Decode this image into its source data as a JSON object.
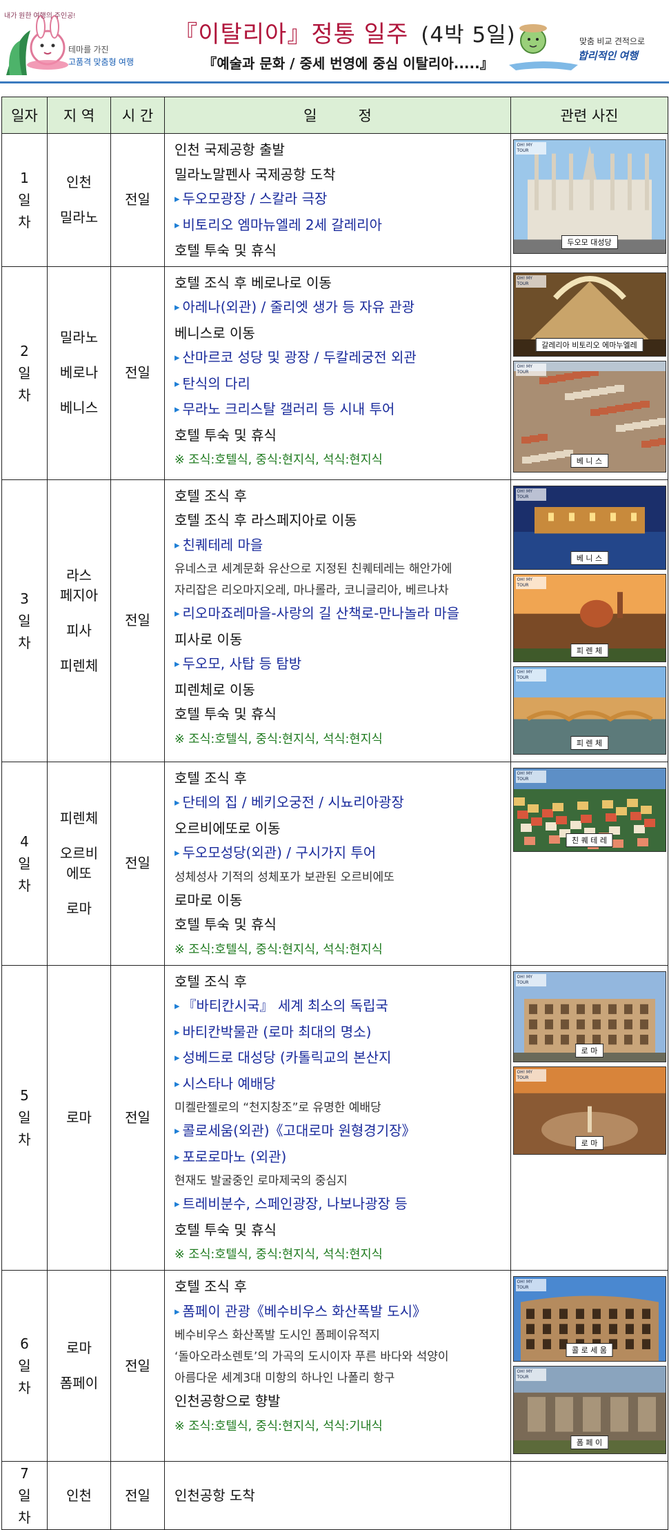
{
  "header": {
    "left_logo_bubble": "내가 원한 여행의 주인공!",
    "left_logo_line1": "테마를 가진",
    "left_logo_line2": "고품격 맞춤형 여행",
    "title": "『이탈리아』정통 일주",
    "duration": "(4박 5일)",
    "subtitle": "『예술과 문화 / 중세 번영에 중심 이탈리아.....』",
    "right_logo_line1": "맞춤 비교 견적으로",
    "right_logo_line2": "합리적인 여행"
  },
  "table": {
    "headers": {
      "day": "일자",
      "region": "지 역",
      "time": "시 간",
      "schedule": "일         정",
      "photos": "관련 사진"
    },
    "stamp": "OH! MY TOUR",
    "rows": [
      {
        "day": [
          "1",
          "일",
          "차"
        ],
        "regions": [
          "인천",
          "밀라노"
        ],
        "time": "전일",
        "lines": [
          {
            "t": "인천 국제공항 출발",
            "k": "plain"
          },
          {
            "t": "밀라노말펜사 국제공항 도착",
            "k": "plain"
          },
          {
            "t": "두오모광장 / 스칼라 극장",
            "k": "hl"
          },
          {
            "t": "비토리오 엠마뉴엘레 2세 갈레리아",
            "k": "hl"
          },
          {
            "t": "호텔 투숙 및 휴식",
            "k": "plain"
          }
        ],
        "photos": [
          {
            "caption": "두오모 대성당",
            "scene": "cathedral"
          }
        ]
      },
      {
        "day": [
          "2",
          "일",
          "차"
        ],
        "regions": [
          "밀라노",
          "베로나",
          "베니스"
        ],
        "time": "전일",
        "lines": [
          {
            "t": "호텔 조식 후 베로나로 이동",
            "k": "plain"
          },
          {
            "t": "아레나(외관) / 줄리엣 생가 등 자유 관광",
            "k": "hl"
          },
          {
            "t": "베니스로 이동",
            "k": "plain"
          },
          {
            "t": "산마르코 성당 및 광장 / 두칼레궁전 외관",
            "k": "hl"
          },
          {
            "t": "탄식의 다리",
            "k": "hl"
          },
          {
            "t": "무라노 크리스탈 갤러리 등 시내 투어",
            "k": "hl"
          },
          {
            "t": "호텔 투숙 및 휴식",
            "k": "plain"
          },
          {
            "t": "※ 조식:호텔식, 중식:현지식, 석식:현지식",
            "k": "ml"
          }
        ],
        "photos": [
          {
            "caption": "갈레리아 비토리오 에마누엘레",
            "scene": "gallery"
          },
          {
            "caption": "베 니 스",
            "scene": "city"
          }
        ]
      },
      {
        "day": [
          "3",
          "일",
          "차"
        ],
        "regions": [
          "라스\n페지아",
          "피사",
          "피렌체"
        ],
        "time": "전일",
        "lines": [
          {
            "t": "호텔 조식 후",
            "k": "plain"
          },
          {
            "t": "호텔 조식 후 라스페지아로 이동",
            "k": "plain"
          },
          {
            "t": "친퀘테레 마을",
            "k": "hl"
          },
          {
            "t": "유네스코 세계문화 유산으로 지정된 친퀘테레는 해안가에",
            "k": "sm"
          },
          {
            "t": "자리잡은 리오마지오레, 마나롤라, 코니글리아, 베르나차",
            "k": "sm"
          },
          {
            "t": "리오마죠레마을-사랑의 길 산책로-만나놀라 마을",
            "k": "hl"
          },
          {
            "t": "피사로 이동",
            "k": "plain"
          },
          {
            "t": "두오모, 사탑 등 탐방",
            "k": "hl"
          },
          {
            "t": "피렌체로 이동",
            "k": "plain"
          },
          {
            "t": "호텔 투숙 및 휴식",
            "k": "plain"
          },
          {
            "t": "※ 조식:호텔식, 중식:현지식, 석식:현지식",
            "k": "ml"
          }
        ],
        "photos": [
          {
            "caption": "베 니 스",
            "scene": "night"
          },
          {
            "caption": "피 렌 체",
            "scene": "sunset"
          },
          {
            "caption": "피 렌 체",
            "scene": "bridge"
          }
        ]
      },
      {
        "day": [
          "4",
          "일",
          "차"
        ],
        "regions": [
          "피렌체",
          "오르비\n에또",
          "로마"
        ],
        "time": "전일",
        "lines": [
          {
            "t": "호텔 조식 후",
            "k": "plain"
          },
          {
            "t": "단테의 집 / 베키오궁전 / 시뇨리아광장",
            "k": "hl"
          },
          {
            "t": "오르비에또로 이동",
            "k": "plain"
          },
          {
            "t": "두오모성당(외관) / 구시가지 투어",
            "k": "hl"
          },
          {
            "t": "성체성사 기적의 성체포가 보관된 오르비에또",
            "k": "sm"
          },
          {
            "t": "로마로 이동",
            "k": "plain"
          },
          {
            "t": "호텔 투숙 및 휴식",
            "k": "plain"
          },
          {
            "t": "※ 조식:호텔식, 중식:현지식, 석식:현지식",
            "k": "ml"
          }
        ],
        "photos": [
          {
            "caption": "친 퀘 테 레",
            "scene": "coast"
          }
        ]
      },
      {
        "day": [
          "5",
          "일",
          "차"
        ],
        "regions": [
          "로마"
        ],
        "time": "전일",
        "lines": [
          {
            "t": "호텔 조식 후",
            "k": "plain"
          },
          {
            "t": "『바티칸시국』 세계 최소의 독립국",
            "k": "hl"
          },
          {
            "t": "바티칸박물관 (로마 최대의 명소)",
            "k": "hl"
          },
          {
            "t": "성베드로 대성당 (카톨릭교의 본산지",
            "k": "hl"
          },
          {
            "t": "시스타나 예배당",
            "k": "hl"
          },
          {
            "t": "미켈란젤로의 “천지창조”로 유명한 예배당",
            "k": "sm"
          },
          {
            "t": "콜로세움(외관)《고대로마 원형경기장》",
            "k": "hl"
          },
          {
            "t": "포로로마노 (외관)",
            "k": "hl"
          },
          {
            "t": "현재도 발굴중인 로마제국의 중심지",
            "k": "sm"
          },
          {
            "t": "트레비분수, 스페인광장, 나보나광장 등",
            "k": "hl"
          },
          {
            "t": "호텔 투숙 및 휴식",
            "k": "plain"
          },
          {
            "t": "※ 조식:호텔식, 중식:현지식, 석식:현지식",
            "k": "ml"
          }
        ],
        "photos": [
          {
            "caption": "로 마",
            "scene": "colosseum"
          },
          {
            "caption": "로 마",
            "scene": "square"
          }
        ]
      },
      {
        "day": [
          "6",
          "일",
          "차"
        ],
        "regions": [
          "로마",
          "폼페이"
        ],
        "time": "전일",
        "lines": [
          {
            "t": "호텔 조식 후",
            "k": "plain"
          },
          {
            "t": "폼페이 관광《베수비우스 화산폭발 도시》",
            "k": "hl"
          },
          {
            "t": "베수비우스 화산폭발 도시인 폼페이유적지",
            "k": "sm"
          },
          {
            "t": "‘돌아오라소렌토’의 가곡의 도시이자 푸른 바다와 석양이",
            "k": "sm"
          },
          {
            "t": "아름다운 세계3대 미항의 하나인 나폴리 항구",
            "k": "sm"
          },
          {
            "t": "인천공항으로 향발",
            "k": "plain"
          },
          {
            "t": "※ 조식:호텔식, 중식:현지식, 석식:기내식",
            "k": "ml"
          }
        ],
        "photos": [
          {
            "caption": "콜 로 세 움",
            "scene": "colosseum2"
          },
          {
            "caption": "폼 페 이",
            "scene": "ruins"
          }
        ]
      },
      {
        "day": [
          "7",
          "일",
          "차"
        ],
        "regions": [
          "인천"
        ],
        "time": "전일",
        "lines": [
          {
            "t": "인천공항 도착",
            "k": "plain"
          }
        ],
        "photos": []
      }
    ]
  }
}
